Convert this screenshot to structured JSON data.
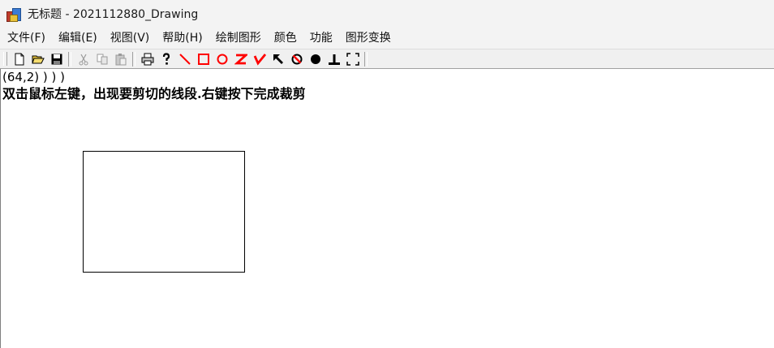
{
  "window": {
    "title": "无标题 - 2021112880_Drawing",
    "icon": "app-icon"
  },
  "menubar": {
    "items": [
      "文件(F)",
      "编辑(E)",
      "视图(V)",
      "帮助(H)",
      "绘制图形",
      "颜色",
      "功能",
      "图形变换"
    ]
  },
  "toolbar": {
    "buttons": [
      {
        "name": "new-file-icon"
      },
      {
        "name": "open-folder-icon"
      },
      {
        "name": "save-icon"
      },
      {
        "name": "cut-icon",
        "disabled": true
      },
      {
        "name": "copy-icon",
        "disabled": true
      },
      {
        "name": "paste-icon",
        "disabled": true
      },
      {
        "name": "print-icon"
      },
      {
        "name": "help-icon"
      },
      {
        "name": "draw-line-icon",
        "color": "#ff0000"
      },
      {
        "name": "draw-rectangle-icon",
        "color": "#ff0000"
      },
      {
        "name": "draw-circle-icon",
        "color": "#ff0000"
      },
      {
        "name": "draw-z-icon",
        "color": "#ff0000"
      },
      {
        "name": "draw-check-icon",
        "color": "#ff0000"
      },
      {
        "name": "arrow-up-left-icon",
        "color": "#000000"
      },
      {
        "name": "no-fill-icon",
        "color": "#000000"
      },
      {
        "name": "filled-circle-icon",
        "color": "#000000"
      },
      {
        "name": "perpendicular-icon",
        "color": "#000000"
      },
      {
        "name": "selection-frame-icon",
        "color": "#000000"
      }
    ]
  },
  "canvas": {
    "coordinate_text": "(64,2) ) ) )",
    "hint_text": "双击鼠标左键，出现要剪切的线段.右键按下完成裁剪"
  }
}
